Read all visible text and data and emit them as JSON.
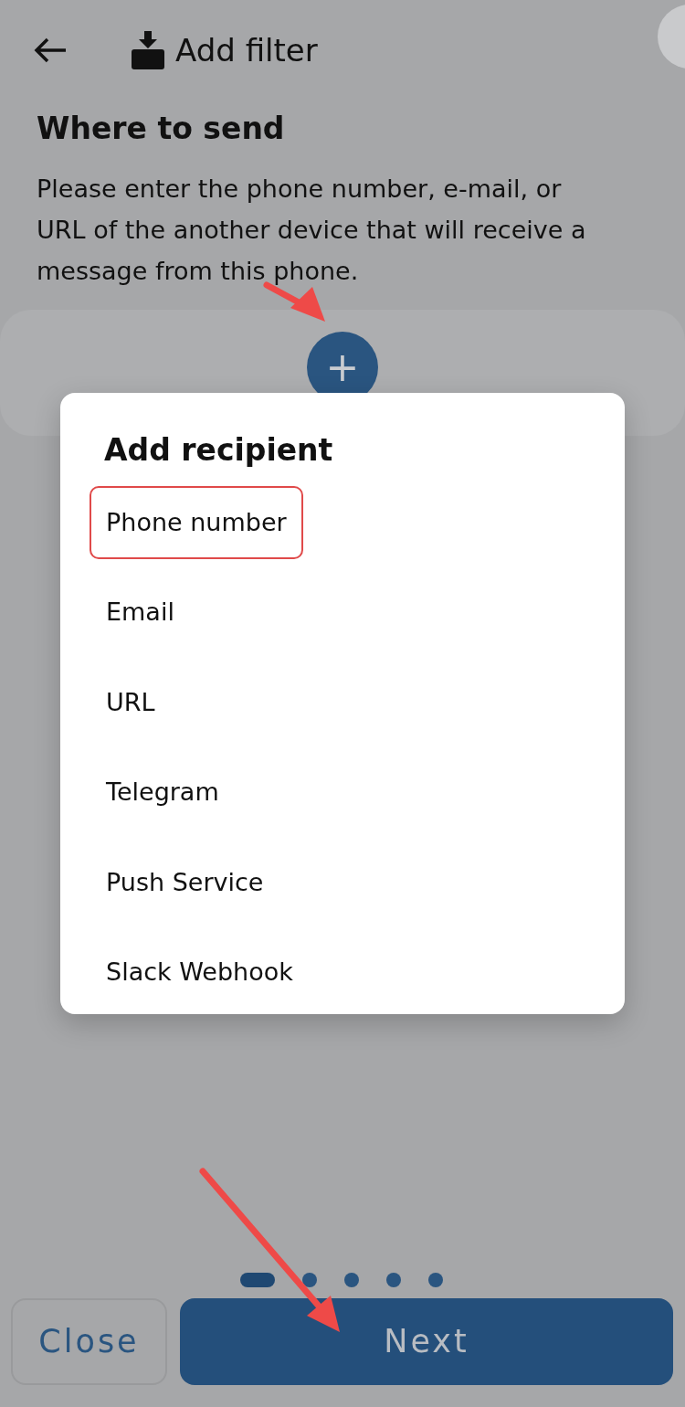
{
  "header": {
    "title": "Add filter"
  },
  "section": {
    "title": "Where to send",
    "description": "Please enter the phone number, e-mail, or URL of the another device that will receive a message from this phone."
  },
  "add_button": {
    "label": "+"
  },
  "dialog": {
    "title": "Add recipient",
    "options": [
      {
        "label": "Phone number",
        "highlighted": true
      },
      {
        "label": "Email",
        "highlighted": false
      },
      {
        "label": "URL",
        "highlighted": false
      },
      {
        "label": "Telegram",
        "highlighted": false
      },
      {
        "label": "Push Service",
        "highlighted": false
      },
      {
        "label": "Slack Webhook",
        "highlighted": false
      }
    ]
  },
  "page_dots": [
    {
      "selected": true
    },
    {
      "selected": false
    },
    {
      "selected": false
    },
    {
      "selected": false
    },
    {
      "selected": false
    }
  ],
  "buttons": [
    {
      "label": "Close",
      "kind": "outline"
    },
    {
      "label": "Next",
      "kind": "primary"
    }
  ]
}
